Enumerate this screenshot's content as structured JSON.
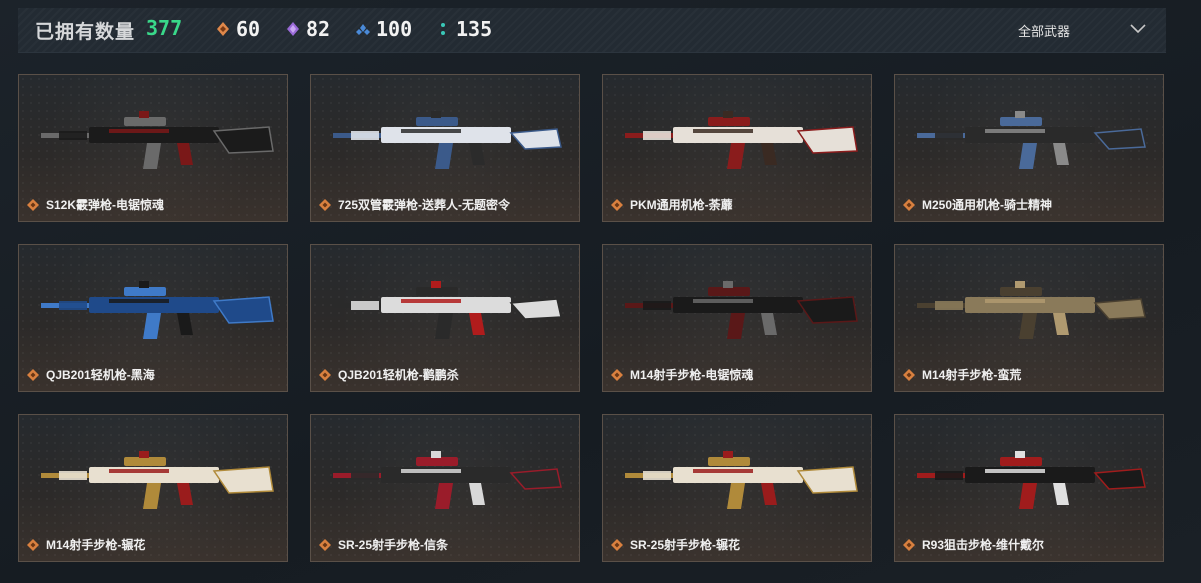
{
  "header": {
    "owned_label": "已拥有数量",
    "owned_count": "377",
    "stats": [
      {
        "icon": "orange-diamond-icon",
        "color": "#e0884a",
        "value": "60"
      },
      {
        "icon": "purple-diamond-icon",
        "color": "#9a6ad8",
        "value": "82"
      },
      {
        "icon": "blue-diamond-icon",
        "color": "#4a8ad8",
        "value": "100"
      },
      {
        "icon": "teal-dots-icon",
        "color": "#3ac8b8",
        "value": "135"
      }
    ],
    "filter_label": "全部武器"
  },
  "colors": {
    "accent_green": "#39d98a",
    "rarity_orange": "#d9803f",
    "card_border": "#5a5048"
  },
  "weapons": [
    {
      "name": "S12K霰弹枪-电锯惊魂",
      "palette": [
        "#1b1b1b",
        "#6a6a6a",
        "#7a1818"
      ]
    },
    {
      "name": "725双管霰弹枪-送葬人-无题密令",
      "palette": [
        "#dfe3ea",
        "#3b5a8a",
        "#2b2b2b"
      ]
    },
    {
      "name": "PKM通用机枪-荼蘼",
      "palette": [
        "#e6e0d8",
        "#8a1c1c",
        "#3a2a22"
      ]
    },
    {
      "name": "M250通用机枪-骑士精神",
      "palette": [
        "#2a2a2a",
        "#4a6a9a",
        "#8a8a8a"
      ]
    },
    {
      "name": "QJB201轻机枪-黑海",
      "palette": [
        "#1f4a8a",
        "#3f7ac8",
        "#1a1a1a"
      ]
    },
    {
      "name": "QJB201轻机枪-鹳鹏杀",
      "palette": [
        "#dcdcdc",
        "#2a2a2a",
        "#b01c1c"
      ]
    },
    {
      "name": "M14射手步枪-电锯惊魂",
      "palette": [
        "#1a1a1a",
        "#5a1818",
        "#6a6a6a"
      ]
    },
    {
      "name": "M14射手步枪-蛮荒",
      "palette": [
        "#8a7a5a",
        "#4a4030",
        "#b09a70"
      ]
    },
    {
      "name": "M14射手步枪-辗花",
      "palette": [
        "#e8e0d0",
        "#b08a3a",
        "#9a1c1c"
      ]
    },
    {
      "name": "SR-25射手步枪-信条",
      "palette": [
        "#2a2a2a",
        "#9a1c2a",
        "#d8d8d8"
      ]
    },
    {
      "name": "SR-25射手步枪-辗花",
      "palette": [
        "#e8e0d0",
        "#b08a3a",
        "#9a1c1c"
      ]
    },
    {
      "name": "R93狙击步枪-维什戴尔",
      "palette": [
        "#1a1a1a",
        "#a01c1c",
        "#e0e0e0"
      ]
    }
  ]
}
